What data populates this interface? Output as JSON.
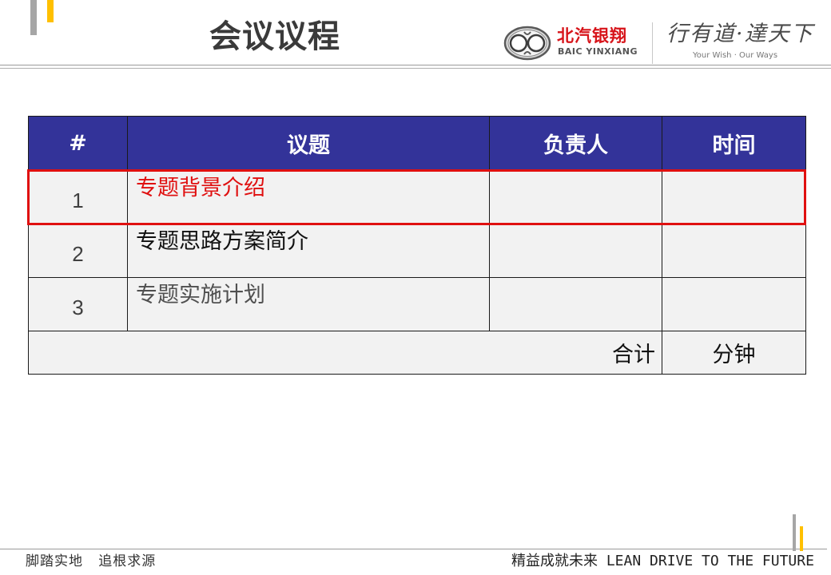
{
  "page": {
    "title": "会议议程"
  },
  "brand": {
    "logo_cn": "北汽银翔",
    "logo_en": "BAIC YINXIANG",
    "slogan_cn": "行有道·達天下",
    "slogan_en": "Your Wish · Our Ways",
    "colors": {
      "brand_red": "#d7141a",
      "accent_yellow": "#ffc000",
      "accent_gray": "#a6a6a6"
    }
  },
  "table": {
    "header_color": "#333399",
    "columns": [
      "#",
      "议题",
      "负责人",
      "时间"
    ],
    "rows": [
      {
        "num": "1",
        "topic": "专题背景介绍",
        "owner": "",
        "time": "",
        "highlighted": true
      },
      {
        "num": "2",
        "topic": "专题思路方案简介",
        "owner": "",
        "time": "",
        "highlighted": false
      },
      {
        "num": "3",
        "topic": "专题实施计划",
        "owner": "",
        "time": "",
        "highlighted": false
      }
    ],
    "total_label": "合计",
    "total_value": "分钟",
    "highlight_color": "#e01010"
  },
  "footer": {
    "left_text": "脚踏实地   追根求源",
    "right_text": "精益成就未来 LEAN DRIVE TO THE FUTURE"
  }
}
